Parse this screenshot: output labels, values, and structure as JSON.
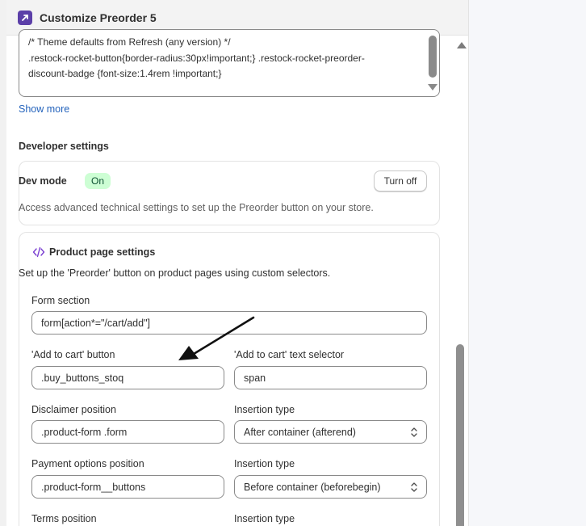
{
  "window": {
    "title": "Customize Preorder 5",
    "app_icon": "restock-rocket-icon",
    "accent": "#5b3fa8"
  },
  "custom_css": {
    "lines": [
      "/* Theme defaults from Refresh (any version) */",
      ".restock-rocket-button{border-radius:30px!important;} .restock-rocket-preorder-",
      "discount-badge {font-size:1.4rem !important;}"
    ],
    "show_more": "Show more"
  },
  "developer": {
    "section_title": "Developer settings",
    "dev_mode_label": "Dev mode",
    "dev_mode_badge": "On",
    "turn_off_label": "Turn off",
    "description": "Access advanced technical settings to set up the Preorder button on your store."
  },
  "product_page": {
    "icon": "code-icon",
    "title": "Product page settings",
    "description": "Set up the 'Preorder' button on product pages using custom selectors.",
    "form_section": {
      "label": "Form section",
      "value": "form[action*=\"/cart/add\"]"
    },
    "add_to_cart_button": {
      "label": "'Add to cart' button",
      "value": ".buy_buttons_stoq"
    },
    "add_to_cart_text": {
      "label": "'Add to cart' text selector",
      "value": "span"
    },
    "disclaimer_position": {
      "label": "Disclaimer position",
      "value": ".product-form .form"
    },
    "disclaimer_insertion": {
      "label": "Insertion type",
      "value": "After container (afterend)"
    },
    "payment_position": {
      "label": "Payment options position",
      "value": ".product-form__buttons"
    },
    "payment_insertion": {
      "label": "Insertion type",
      "value": "Before container (beforebegin)"
    },
    "terms_position": {
      "label": "Terms position"
    },
    "terms_insertion": {
      "label": "Insertion type"
    }
  },
  "colors": {
    "badge_bg": "#cdfed4",
    "badge_text": "#0c5132",
    "link": "#2463bc"
  }
}
